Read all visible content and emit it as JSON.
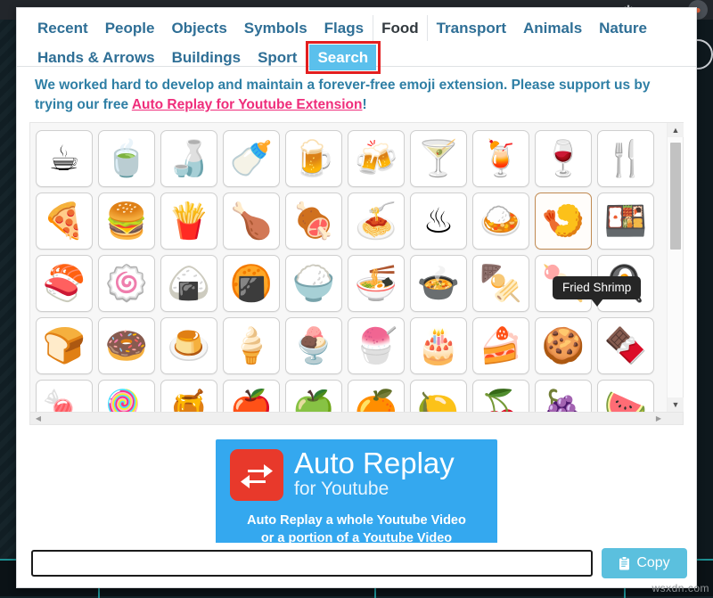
{
  "browser": {
    "back_icon": "back-arrow-icon",
    "extension_icon": "puzzle-icon",
    "profile_icon": "profile-avatar-icon"
  },
  "popup": {
    "tabs_row1": [
      {
        "label": "Recent",
        "state": "normal"
      },
      {
        "label": "People",
        "state": "normal"
      },
      {
        "label": "Objects",
        "state": "normal"
      },
      {
        "label": "Symbols",
        "state": "normal"
      },
      {
        "label": "Flags",
        "state": "normal"
      },
      {
        "label": "Food",
        "state": "active"
      },
      {
        "label": "Transport",
        "state": "normal"
      },
      {
        "label": "Animals",
        "state": "normal"
      },
      {
        "label": "Nature",
        "state": "normal"
      }
    ],
    "tabs_row2": [
      {
        "label": "Hands & Arrows",
        "state": "normal"
      },
      {
        "label": "Buildings",
        "state": "normal"
      },
      {
        "label": "Sport",
        "state": "normal"
      },
      {
        "label": "Search",
        "state": "selected"
      }
    ],
    "highlight_color": "#e31f20",
    "selected_tab_color": "#5bc0ec",
    "promo": {
      "text_before": "We worked hard to develop and maintain a forever-free emoji extension. Please support us by trying our free ",
      "link_text": "Auto Replay for Youtube Extension",
      "text_after": "!",
      "text_color": "#2f7fa5",
      "link_color": "#ef2d7b"
    },
    "tooltip": {
      "text": "Fried Shrimp",
      "visible": true
    },
    "emoji_rows": [
      [
        {
          "name": "hot-beverage",
          "glyph": "☕"
        },
        {
          "name": "teacup-without-handle",
          "glyph": "🍵"
        },
        {
          "name": "sake",
          "glyph": "🍶"
        },
        {
          "name": "baby-bottle",
          "glyph": "🍼"
        },
        {
          "name": "beer-mug",
          "glyph": "🍺"
        },
        {
          "name": "clinking-beer-mugs",
          "glyph": "🍻"
        },
        {
          "name": "cocktail-glass",
          "glyph": "🍸"
        },
        {
          "name": "tropical-drink",
          "glyph": "🍹"
        },
        {
          "name": "wine-glass",
          "glyph": "🍷"
        },
        {
          "name": "fork-and-knife",
          "glyph": "🍴"
        }
      ],
      [
        {
          "name": "pizza",
          "glyph": "🍕"
        },
        {
          "name": "hamburger",
          "glyph": "🍔"
        },
        {
          "name": "french-fries",
          "glyph": "🍟"
        },
        {
          "name": "poultry-leg",
          "glyph": "🍗"
        },
        {
          "name": "meat-on-bone",
          "glyph": "🍖"
        },
        {
          "name": "spaghetti",
          "glyph": "🍝"
        },
        {
          "name": "steaming-bowl-hot",
          "glyph": "♨"
        },
        {
          "name": "curry-rice",
          "glyph": "🍛"
        },
        {
          "name": "fried-shrimp",
          "glyph": "🍤",
          "hovered": true
        },
        {
          "name": "bento-box",
          "glyph": "🍱"
        }
      ],
      [
        {
          "name": "sushi",
          "glyph": "🍣"
        },
        {
          "name": "fish-cake-with-swirl",
          "glyph": "🍥"
        },
        {
          "name": "rice-ball",
          "glyph": "🍙"
        },
        {
          "name": "rice-cracker",
          "glyph": "🍘"
        },
        {
          "name": "cooked-rice",
          "glyph": "🍚"
        },
        {
          "name": "steaming-bowl-noodles",
          "glyph": "🍜"
        },
        {
          "name": "pot-of-food",
          "glyph": "🍲"
        },
        {
          "name": "oden",
          "glyph": "🍢"
        },
        {
          "name": "dango",
          "glyph": "🍡"
        },
        {
          "name": "cooking-fried-egg",
          "glyph": "🍳"
        }
      ],
      [
        {
          "name": "bread",
          "glyph": "🍞"
        },
        {
          "name": "doughnut",
          "glyph": "🍩"
        },
        {
          "name": "custard",
          "glyph": "🍮"
        },
        {
          "name": "soft-ice-cream",
          "glyph": "🍦"
        },
        {
          "name": "ice-cream",
          "glyph": "🍨"
        },
        {
          "name": "shaved-ice",
          "glyph": "🍧"
        },
        {
          "name": "birthday-cake",
          "glyph": "🎂"
        },
        {
          "name": "shortcake",
          "glyph": "🍰"
        },
        {
          "name": "cookie",
          "glyph": "🍪"
        },
        {
          "name": "chocolate-bar",
          "glyph": "🍫"
        }
      ],
      [
        {
          "name": "candy",
          "glyph": "🍬"
        },
        {
          "name": "lollipop",
          "glyph": "🍭"
        },
        {
          "name": "honey-pot",
          "glyph": "🍯"
        },
        {
          "name": "red-apple",
          "glyph": "🍎"
        },
        {
          "name": "green-apple",
          "glyph": "🍏"
        },
        {
          "name": "tangerine",
          "glyph": "🍊"
        },
        {
          "name": "lemon",
          "glyph": "🍋"
        },
        {
          "name": "cherries",
          "glyph": "🍒"
        },
        {
          "name": "grapes",
          "glyph": "🍇"
        },
        {
          "name": "watermelon",
          "glyph": "🍉"
        }
      ]
    ],
    "scroll": {
      "up_arrow": "▲",
      "down_arrow": "▼",
      "left_arrow": "◀",
      "right_arrow": "▶"
    },
    "banner": {
      "icon": "repeat-loop-icon",
      "icon_bg": "#e8392b",
      "bg": "#34a8ef",
      "title_line1": "Auto Replay",
      "title_line2": "for Youtube",
      "sub_line1": "Auto Replay a whole Youtube Video",
      "sub_line2": "or a portion of a Youtube Video"
    },
    "bottom": {
      "input_value": "",
      "input_placeholder": "",
      "copy_label": "Copy",
      "copy_icon": "clipboard-icon",
      "copy_color": "#5bc0de"
    }
  },
  "watermark": {
    "text": "wsxdn.com"
  }
}
